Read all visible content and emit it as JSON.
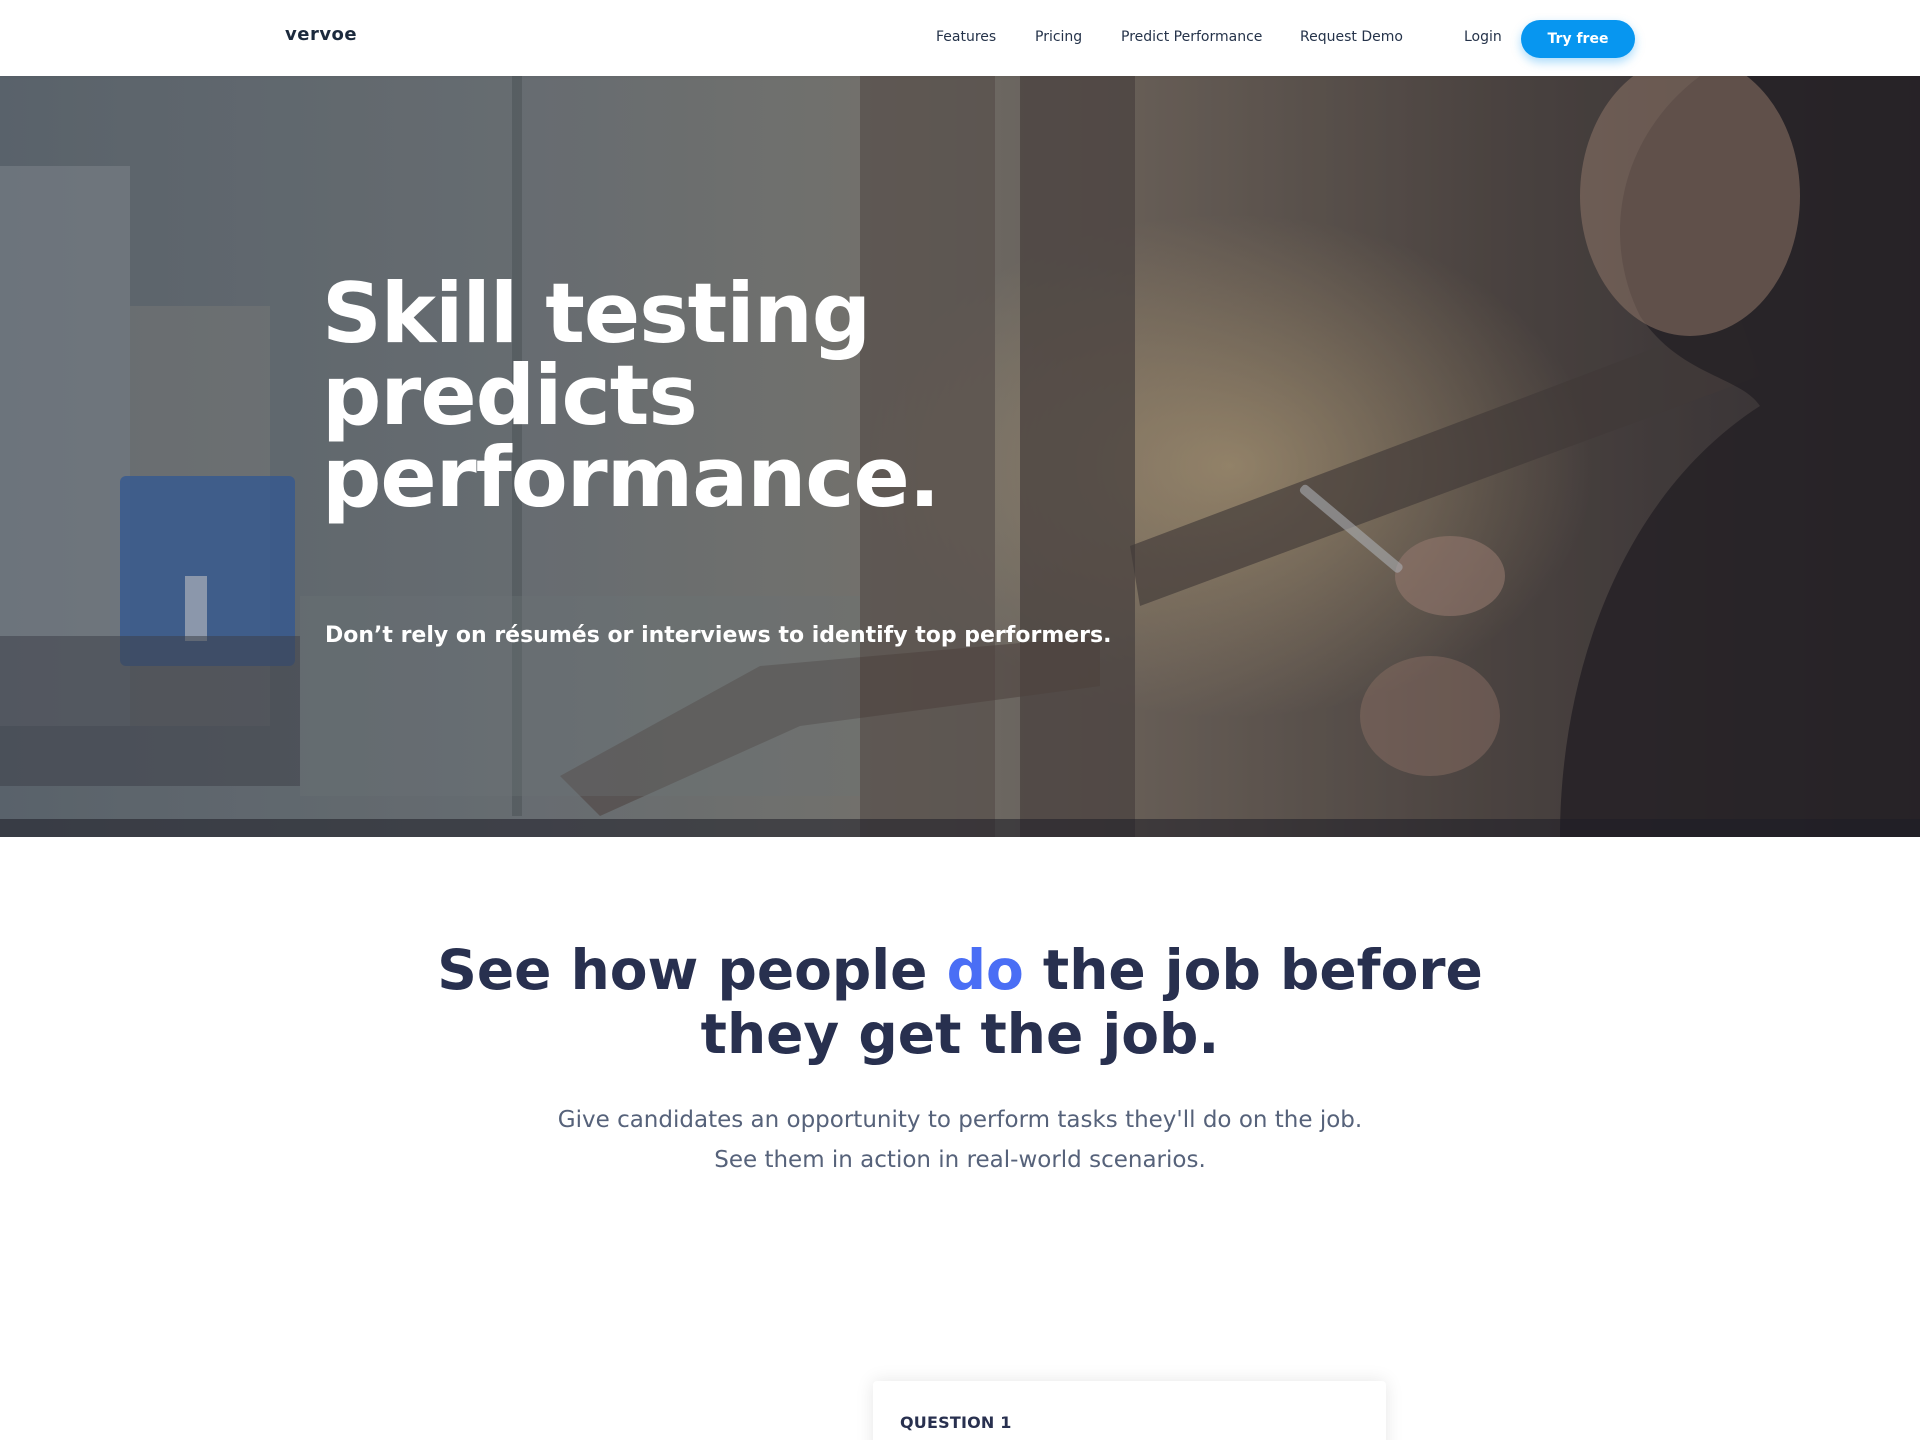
{
  "brand": {
    "logo_text": "vervoe",
    "accent_color": "#0796f0",
    "highlight_color": "#4a6ef5"
  },
  "nav": {
    "links": [
      {
        "label": "Features"
      },
      {
        "label": "Pricing"
      },
      {
        "label": "Predict Performance"
      },
      {
        "label": "Request Demo"
      }
    ],
    "login_label": "Login",
    "cta_label": "Try free"
  },
  "hero": {
    "title": "Skill testing predicts performance.",
    "subtitle": "Don’t rely on résumés or interviews to identify top performers."
  },
  "section": {
    "title_before": "See how people ",
    "title_highlight": "do",
    "title_after": " the job before they get the job.",
    "description_line1": "Give candidates an opportunity to perform tasks they'll do on the job.",
    "description_line2": "See them in action in real-world scenarios."
  },
  "question_card": {
    "label": "QUESTION 1"
  }
}
